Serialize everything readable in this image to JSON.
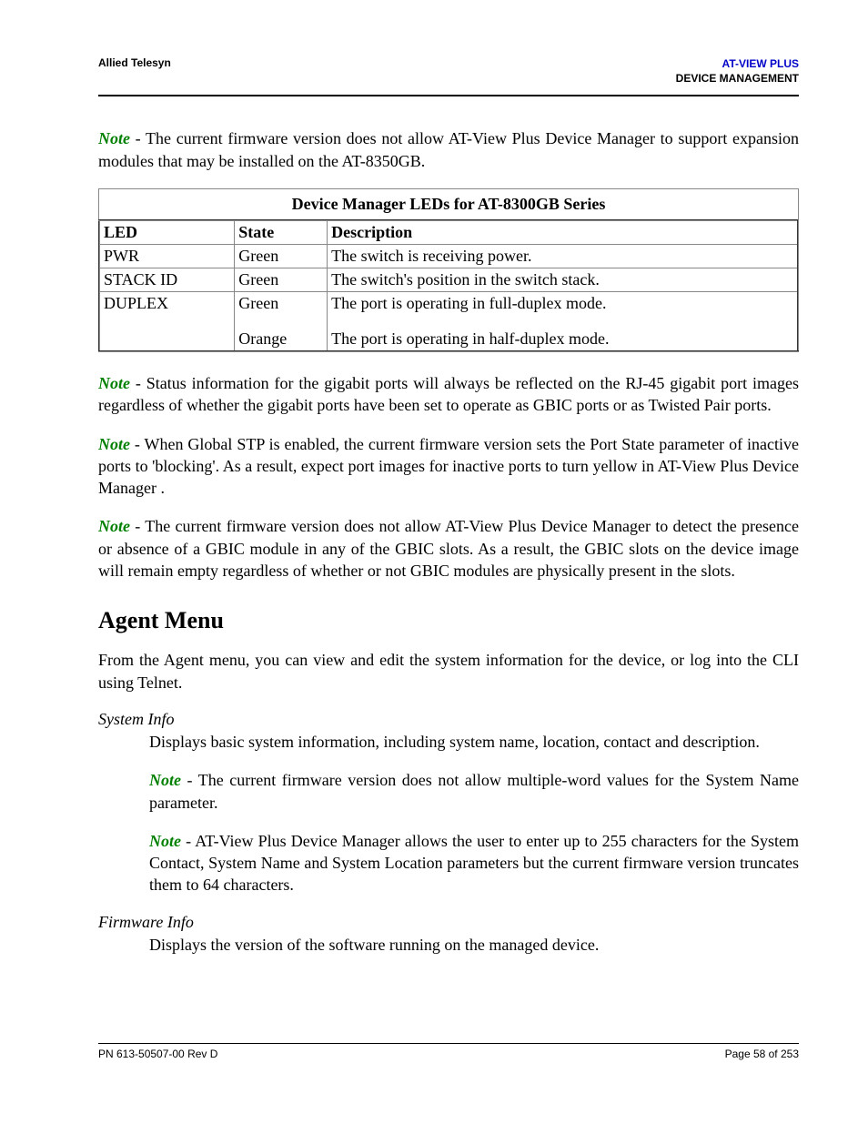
{
  "header": {
    "left": "Allied Telesyn",
    "product": "AT-VIEW PLUS",
    "mgmt": "DEVICE MANAGEMENT"
  },
  "notes": {
    "label": "Note",
    "n1": " - The current firmware version does not allow AT-View Plus Device Manager to support expansion modules that may be installed on the AT-8350GB.",
    "n2": " - Status information for the gigabit ports will always be reflected on the RJ-45 gigabit port images regardless of whether the gigabit ports have been set to operate as GBIC ports or as Twisted Pair ports.",
    "n3": " - When Global STP is enabled, the current firmware version sets the Port State parameter of inactive ports to 'blocking'. As a result, expect port images for inactive ports to turn yellow in AT-View Plus Device Manager .",
    "n4": " - The current firmware version does not allow AT-View Plus Device Manager to detect the presence or absence of a GBIC module in any of the GBIC slots. As a result, the GBIC slots on the device image will remain empty regardless of whether or not GBIC modules are physically present in the slots.",
    "sys1": " - The current firmware version does not allow multiple-word values for the System Name parameter.",
    "sys2": " - AT-View Plus Device Manager allows the user to enter up to 255 characters for the System Contact, System Name and System Location parameters but the current firmware version truncates them to 64 characters."
  },
  "table": {
    "caption": "Device Manager LEDs for AT-8300GB Series",
    "headers": {
      "c0": "LED",
      "c1": "State",
      "c2": "Description"
    },
    "rows": [
      {
        "led": "PWR",
        "state": "Green",
        "desc": "The switch is receiving power."
      },
      {
        "led": "STACK ID",
        "state": "Green",
        "desc": "The switch's position in the switch stack."
      },
      {
        "led": "DUPLEX",
        "state": "Green",
        "state2": "Orange",
        "desc": "The port is operating in full-duplex mode.",
        "desc2": "The port is operating in half-duplex mode."
      }
    ]
  },
  "section": {
    "title": "Agent Menu",
    "intro": "From the Agent menu, you can view and edit the system information for the device, or log into the CLI using Telnet.",
    "sysinfo_title": "System Info",
    "sysinfo_desc": "Displays basic system information, including system name, location, contact and description.",
    "fwinfo_title": "Firmware Info",
    "fwinfo_desc": "Displays the version of the software running on the managed device."
  },
  "footer": {
    "left": "PN 613-50507-00 Rev D",
    "right": "Page 58 of 253"
  }
}
